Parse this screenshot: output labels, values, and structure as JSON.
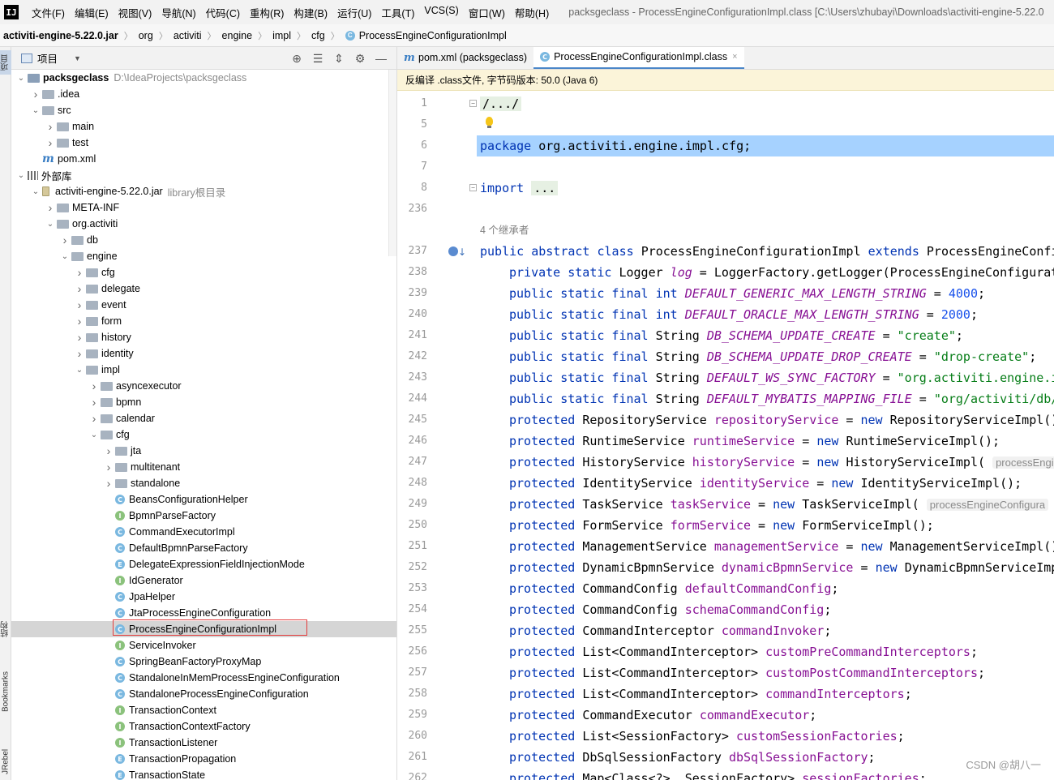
{
  "app": {
    "logo": "IJ",
    "menu": [
      "文件(F)",
      "编辑(E)",
      "视图(V)",
      "导航(N)",
      "代码(C)",
      "重构(R)",
      "构建(B)",
      "运行(U)",
      "工具(T)",
      "VCS(S)",
      "窗口(W)",
      "帮助(H)"
    ],
    "window_title": "packsgeclass - ProcessEngineConfigurationImpl.class [C:\\Users\\zhubayi\\Downloads\\activiti-engine-5.22.0"
  },
  "breadcrumb": [
    "activiti-engine-5.22.0.jar",
    "org",
    "activiti",
    "engine",
    "impl",
    "cfg",
    "ProcessEngineConfigurationImpl"
  ],
  "left_strip": {
    "project": "项目",
    "structure": "结构",
    "bookmarks": "Bookmarks",
    "jrebel": "JRebel"
  },
  "project_panel": {
    "view_label": "项目",
    "tree": [
      {
        "depth": 0,
        "chev": "down",
        "icon": "proj",
        "label": "packsgeclass",
        "sub": "D:\\IdeaProjects\\packsgeclass",
        "bold": true
      },
      {
        "depth": 1,
        "chev": "right",
        "icon": "folder",
        "label": ".idea"
      },
      {
        "depth": 1,
        "chev": "down",
        "icon": "folder",
        "label": "src"
      },
      {
        "depth": 2,
        "chev": "right",
        "icon": "folder",
        "label": "main"
      },
      {
        "depth": 2,
        "chev": "right",
        "icon": "folder",
        "label": "test"
      },
      {
        "depth": 1,
        "chev": "none",
        "icon": "maven",
        "label": "pom.xml"
      },
      {
        "depth": 0,
        "chev": "down",
        "icon": "lib",
        "label": "外部库"
      },
      {
        "depth": 1,
        "chev": "down",
        "icon": "jar",
        "label": "activiti-engine-5.22.0.jar",
        "sub": "library根目录"
      },
      {
        "depth": 2,
        "chev": "right",
        "icon": "folder",
        "label": "META-INF"
      },
      {
        "depth": 2,
        "chev": "down",
        "icon": "folder",
        "label": "org.activiti"
      },
      {
        "depth": 3,
        "chev": "right",
        "icon": "folder",
        "label": "db"
      },
      {
        "depth": 3,
        "chev": "down",
        "icon": "folder",
        "label": "engine"
      },
      {
        "depth": 4,
        "chev": "right",
        "icon": "folder",
        "label": "cfg"
      },
      {
        "depth": 4,
        "chev": "right",
        "icon": "folder",
        "label": "delegate"
      },
      {
        "depth": 4,
        "chev": "right",
        "icon": "folder",
        "label": "event"
      },
      {
        "depth": 4,
        "chev": "right",
        "icon": "folder",
        "label": "form"
      },
      {
        "depth": 4,
        "chev": "right",
        "icon": "folder",
        "label": "history"
      },
      {
        "depth": 4,
        "chev": "right",
        "icon": "folder",
        "label": "identity"
      },
      {
        "depth": 4,
        "chev": "down",
        "icon": "folder",
        "label": "impl"
      },
      {
        "depth": 5,
        "chev": "right",
        "icon": "folder",
        "label": "asyncexecutor"
      },
      {
        "depth": 5,
        "chev": "right",
        "icon": "folder",
        "label": "bpmn"
      },
      {
        "depth": 5,
        "chev": "right",
        "icon": "folder",
        "label": "calendar"
      },
      {
        "depth": 5,
        "chev": "down",
        "icon": "folder",
        "label": "cfg"
      },
      {
        "depth": 6,
        "chev": "right",
        "icon": "folder",
        "label": "jta"
      },
      {
        "depth": 6,
        "chev": "right",
        "icon": "folder",
        "label": "multitenant"
      },
      {
        "depth": 6,
        "chev": "right",
        "icon": "folder",
        "label": "standalone"
      },
      {
        "depth": 6,
        "chev": "none",
        "icon": "class",
        "label": "BeansConfigurationHelper"
      },
      {
        "depth": 6,
        "chev": "none",
        "icon": "interface",
        "label": "BpmnParseFactory"
      },
      {
        "depth": 6,
        "chev": "none",
        "icon": "class",
        "label": "CommandExecutorImpl"
      },
      {
        "depth": 6,
        "chev": "none",
        "icon": "class",
        "label": "DefaultBpmnParseFactory"
      },
      {
        "depth": 6,
        "chev": "none",
        "icon": "enum",
        "label": "DelegateExpressionFieldInjectionMode"
      },
      {
        "depth": 6,
        "chev": "none",
        "icon": "interface",
        "label": "IdGenerator"
      },
      {
        "depth": 6,
        "chev": "none",
        "icon": "class",
        "label": "JpaHelper"
      },
      {
        "depth": 6,
        "chev": "none",
        "icon": "class",
        "label": "JtaProcessEngineConfiguration"
      },
      {
        "depth": 6,
        "chev": "none",
        "icon": "class",
        "label": "ProcessEngineConfigurationImpl",
        "selected": true
      },
      {
        "depth": 6,
        "chev": "none",
        "icon": "interface",
        "label": "ServiceInvoker"
      },
      {
        "depth": 6,
        "chev": "none",
        "icon": "class",
        "label": "SpringBeanFactoryProxyMap"
      },
      {
        "depth": 6,
        "chev": "none",
        "icon": "class",
        "label": "StandaloneInMemProcessEngineConfiguration"
      },
      {
        "depth": 6,
        "chev": "none",
        "icon": "class",
        "label": "StandaloneProcessEngineConfiguration"
      },
      {
        "depth": 6,
        "chev": "none",
        "icon": "interface",
        "label": "TransactionContext"
      },
      {
        "depth": 6,
        "chev": "none",
        "icon": "interface",
        "label": "TransactionContextFactory"
      },
      {
        "depth": 6,
        "chev": "none",
        "icon": "interface",
        "label": "TransactionListener"
      },
      {
        "depth": 6,
        "chev": "none",
        "icon": "enum",
        "label": "TransactionPropagation"
      },
      {
        "depth": 6,
        "chev": "none",
        "icon": "enum",
        "label": "TransactionState"
      }
    ]
  },
  "editor": {
    "tabs": [
      {
        "icon": "maven",
        "label": "pom.xml (packsgeclass)",
        "active": false
      },
      {
        "icon": "class",
        "label": "ProcessEngineConfigurationImpl.class",
        "active": true
      }
    ],
    "banner": "反编译 .class文件, 字节码版本: 50.0 (Java 6)",
    "inheritors_hint": "4 个继承者",
    "lines": [
      {
        "n": "1",
        "fold": true,
        "tokens": [
          [
            "fold",
            "/.../"
          ]
        ]
      },
      {
        "n": "5",
        "bulb": true,
        "tokens": []
      },
      {
        "n": "6",
        "hl": true,
        "tokens": [
          [
            "kw",
            "package "
          ],
          [
            "ident",
            "org.activiti.engine.impl.cfg;"
          ]
        ]
      },
      {
        "n": "7",
        "tokens": []
      },
      {
        "n": "8",
        "fold": true,
        "tokens": [
          [
            "kw",
            "import "
          ],
          [
            "fold",
            "..."
          ]
        ]
      },
      {
        "n": "236",
        "tokens": []
      },
      {
        "n": "",
        "hint": true,
        "tokens": []
      },
      {
        "n": "237",
        "impl": true,
        "tokens": [
          [
            "kw",
            "public abstract class "
          ],
          [
            "ident",
            "ProcessEngineConfigurationImpl "
          ],
          [
            "kw",
            "extends "
          ],
          [
            "ident",
            "ProcessEngineConfi"
          ]
        ]
      },
      {
        "n": "238",
        "indent": 1,
        "tokens": [
          [
            "kw",
            "private static "
          ],
          [
            "ident",
            "Logger "
          ],
          [
            "cst",
            "log"
          ],
          [
            "ident",
            " = LoggerFactory.getLogger(ProcessEngineConfigurat"
          ]
        ]
      },
      {
        "n": "239",
        "indent": 1,
        "tokens": [
          [
            "kw",
            "public static final int "
          ],
          [
            "cst",
            "DEFAULT_GENERIC_MAX_LENGTH_STRING"
          ],
          [
            "ident",
            " = "
          ],
          [
            "num",
            "4000"
          ],
          [
            "ident",
            ";"
          ]
        ]
      },
      {
        "n": "240",
        "indent": 1,
        "tokens": [
          [
            "kw",
            "public static final int "
          ],
          [
            "cst",
            "DEFAULT_ORACLE_MAX_LENGTH_STRING"
          ],
          [
            "ident",
            " = "
          ],
          [
            "num",
            "2000"
          ],
          [
            "ident",
            ";"
          ]
        ]
      },
      {
        "n": "241",
        "indent": 1,
        "tokens": [
          [
            "kw",
            "public static final "
          ],
          [
            "ident",
            "String "
          ],
          [
            "cst",
            "DB_SCHEMA_UPDATE_CREATE"
          ],
          [
            "ident",
            " = "
          ],
          [
            "str",
            "\"create\""
          ],
          [
            "ident",
            ";"
          ]
        ]
      },
      {
        "n": "242",
        "indent": 1,
        "tokens": [
          [
            "kw",
            "public static final "
          ],
          [
            "ident",
            "String "
          ],
          [
            "cst",
            "DB_SCHEMA_UPDATE_DROP_CREATE"
          ],
          [
            "ident",
            " = "
          ],
          [
            "str",
            "\"drop-create\""
          ],
          [
            "ident",
            ";"
          ]
        ]
      },
      {
        "n": "243",
        "indent": 1,
        "tokens": [
          [
            "kw",
            "public static final "
          ],
          [
            "ident",
            "String "
          ],
          [
            "cst",
            "DEFAULT_WS_SYNC_FACTORY"
          ],
          [
            "ident",
            " = "
          ],
          [
            "str",
            "\"org.activiti.engine.i"
          ]
        ]
      },
      {
        "n": "244",
        "indent": 1,
        "tokens": [
          [
            "kw",
            "public static final "
          ],
          [
            "ident",
            "String "
          ],
          [
            "cst",
            "DEFAULT_MYBATIS_MAPPING_FILE"
          ],
          [
            "ident",
            " = "
          ],
          [
            "str",
            "\"org/activiti/db/"
          ]
        ]
      },
      {
        "n": "245",
        "indent": 1,
        "tokens": [
          [
            "kw",
            "protected "
          ],
          [
            "ident",
            "RepositoryService "
          ],
          [
            "fld",
            "repositoryService"
          ],
          [
            "ident",
            " = "
          ],
          [
            "kw",
            "new "
          ],
          [
            "ident",
            "RepositoryServiceImpl()"
          ]
        ]
      },
      {
        "n": "246",
        "indent": 1,
        "tokens": [
          [
            "kw",
            "protected "
          ],
          [
            "ident",
            "RuntimeService "
          ],
          [
            "fld",
            "runtimeService"
          ],
          [
            "ident",
            " = "
          ],
          [
            "kw",
            "new "
          ],
          [
            "ident",
            "RuntimeServiceImpl();"
          ]
        ]
      },
      {
        "n": "247",
        "indent": 1,
        "tokens": [
          [
            "kw",
            "protected "
          ],
          [
            "ident",
            "HistoryService "
          ],
          [
            "fld",
            "historyService"
          ],
          [
            "ident",
            " = "
          ],
          [
            "kw",
            "new "
          ],
          [
            "ident",
            "HistoryServiceImpl( "
          ],
          [
            "hint",
            "processEngi"
          ]
        ]
      },
      {
        "n": "248",
        "indent": 1,
        "tokens": [
          [
            "kw",
            "protected "
          ],
          [
            "ident",
            "IdentityService "
          ],
          [
            "fld",
            "identityService"
          ],
          [
            "ident",
            " = "
          ],
          [
            "kw",
            "new "
          ],
          [
            "ident",
            "IdentityServiceImpl();"
          ]
        ]
      },
      {
        "n": "249",
        "indent": 1,
        "tokens": [
          [
            "kw",
            "protected "
          ],
          [
            "ident",
            "TaskService "
          ],
          [
            "fld",
            "taskService"
          ],
          [
            "ident",
            " = "
          ],
          [
            "kw",
            "new "
          ],
          [
            "ident",
            "TaskServiceImpl( "
          ],
          [
            "hint",
            "processEngineConfigura"
          ]
        ]
      },
      {
        "n": "250",
        "indent": 1,
        "tokens": [
          [
            "kw",
            "protected "
          ],
          [
            "ident",
            "FormService "
          ],
          [
            "fld",
            "formService"
          ],
          [
            "ident",
            " = "
          ],
          [
            "kw",
            "new "
          ],
          [
            "ident",
            "FormServiceImpl();"
          ]
        ]
      },
      {
        "n": "251",
        "indent": 1,
        "tokens": [
          [
            "kw",
            "protected "
          ],
          [
            "ident",
            "ManagementService "
          ],
          [
            "fld",
            "managementService"
          ],
          [
            "ident",
            " = "
          ],
          [
            "kw",
            "new "
          ],
          [
            "ident",
            "ManagementServiceImpl()"
          ]
        ]
      },
      {
        "n": "252",
        "indent": 1,
        "tokens": [
          [
            "kw",
            "protected "
          ],
          [
            "ident",
            "DynamicBpmnService "
          ],
          [
            "fld",
            "dynamicBpmnService"
          ],
          [
            "ident",
            " = "
          ],
          [
            "kw",
            "new "
          ],
          [
            "ident",
            "DynamicBpmnServiceImp"
          ]
        ]
      },
      {
        "n": "253",
        "indent": 1,
        "tokens": [
          [
            "kw",
            "protected "
          ],
          [
            "ident",
            "CommandConfig "
          ],
          [
            "fld",
            "defaultCommandConfig"
          ],
          [
            "ident",
            ";"
          ]
        ]
      },
      {
        "n": "254",
        "indent": 1,
        "tokens": [
          [
            "kw",
            "protected "
          ],
          [
            "ident",
            "CommandConfig "
          ],
          [
            "fld",
            "schemaCommandConfig"
          ],
          [
            "ident",
            ";"
          ]
        ]
      },
      {
        "n": "255",
        "indent": 1,
        "tokens": [
          [
            "kw",
            "protected "
          ],
          [
            "ident",
            "CommandInterceptor "
          ],
          [
            "fld",
            "commandInvoker"
          ],
          [
            "ident",
            ";"
          ]
        ]
      },
      {
        "n": "256",
        "indent": 1,
        "tokens": [
          [
            "kw",
            "protected "
          ],
          [
            "ident",
            "List<CommandInterceptor> "
          ],
          [
            "fld",
            "customPreCommandInterceptors"
          ],
          [
            "ident",
            ";"
          ]
        ]
      },
      {
        "n": "257",
        "indent": 1,
        "tokens": [
          [
            "kw",
            "protected "
          ],
          [
            "ident",
            "List<CommandInterceptor> "
          ],
          [
            "fld",
            "customPostCommandInterceptors"
          ],
          [
            "ident",
            ";"
          ]
        ]
      },
      {
        "n": "258",
        "indent": 1,
        "tokens": [
          [
            "kw",
            "protected "
          ],
          [
            "ident",
            "List<CommandInterceptor> "
          ],
          [
            "fld",
            "commandInterceptors"
          ],
          [
            "ident",
            ";"
          ]
        ]
      },
      {
        "n": "259",
        "indent": 1,
        "tokens": [
          [
            "kw",
            "protected "
          ],
          [
            "ident",
            "CommandExecutor "
          ],
          [
            "fld",
            "commandExecutor"
          ],
          [
            "ident",
            ";"
          ]
        ]
      },
      {
        "n": "260",
        "indent": 1,
        "tokens": [
          [
            "kw",
            "protected "
          ],
          [
            "ident",
            "List<SessionFactory> "
          ],
          [
            "fld",
            "customSessionFactories"
          ],
          [
            "ident",
            ";"
          ]
        ]
      },
      {
        "n": "261",
        "indent": 1,
        "tokens": [
          [
            "kw",
            "protected "
          ],
          [
            "ident",
            "DbSqlSessionFactory "
          ],
          [
            "fld",
            "dbSqlSessionFactory"
          ],
          [
            "ident",
            ";"
          ]
        ]
      },
      {
        "n": "262",
        "indent": 1,
        "tokens": [
          [
            "kw",
            "protected "
          ],
          [
            "ident",
            "Map<Class<?>, SessionFactory> "
          ],
          [
            "fld",
            "sessionFactories"
          ],
          [
            "ident",
            ";"
          ]
        ]
      }
    ]
  },
  "watermark": "CSDN @胡八一"
}
